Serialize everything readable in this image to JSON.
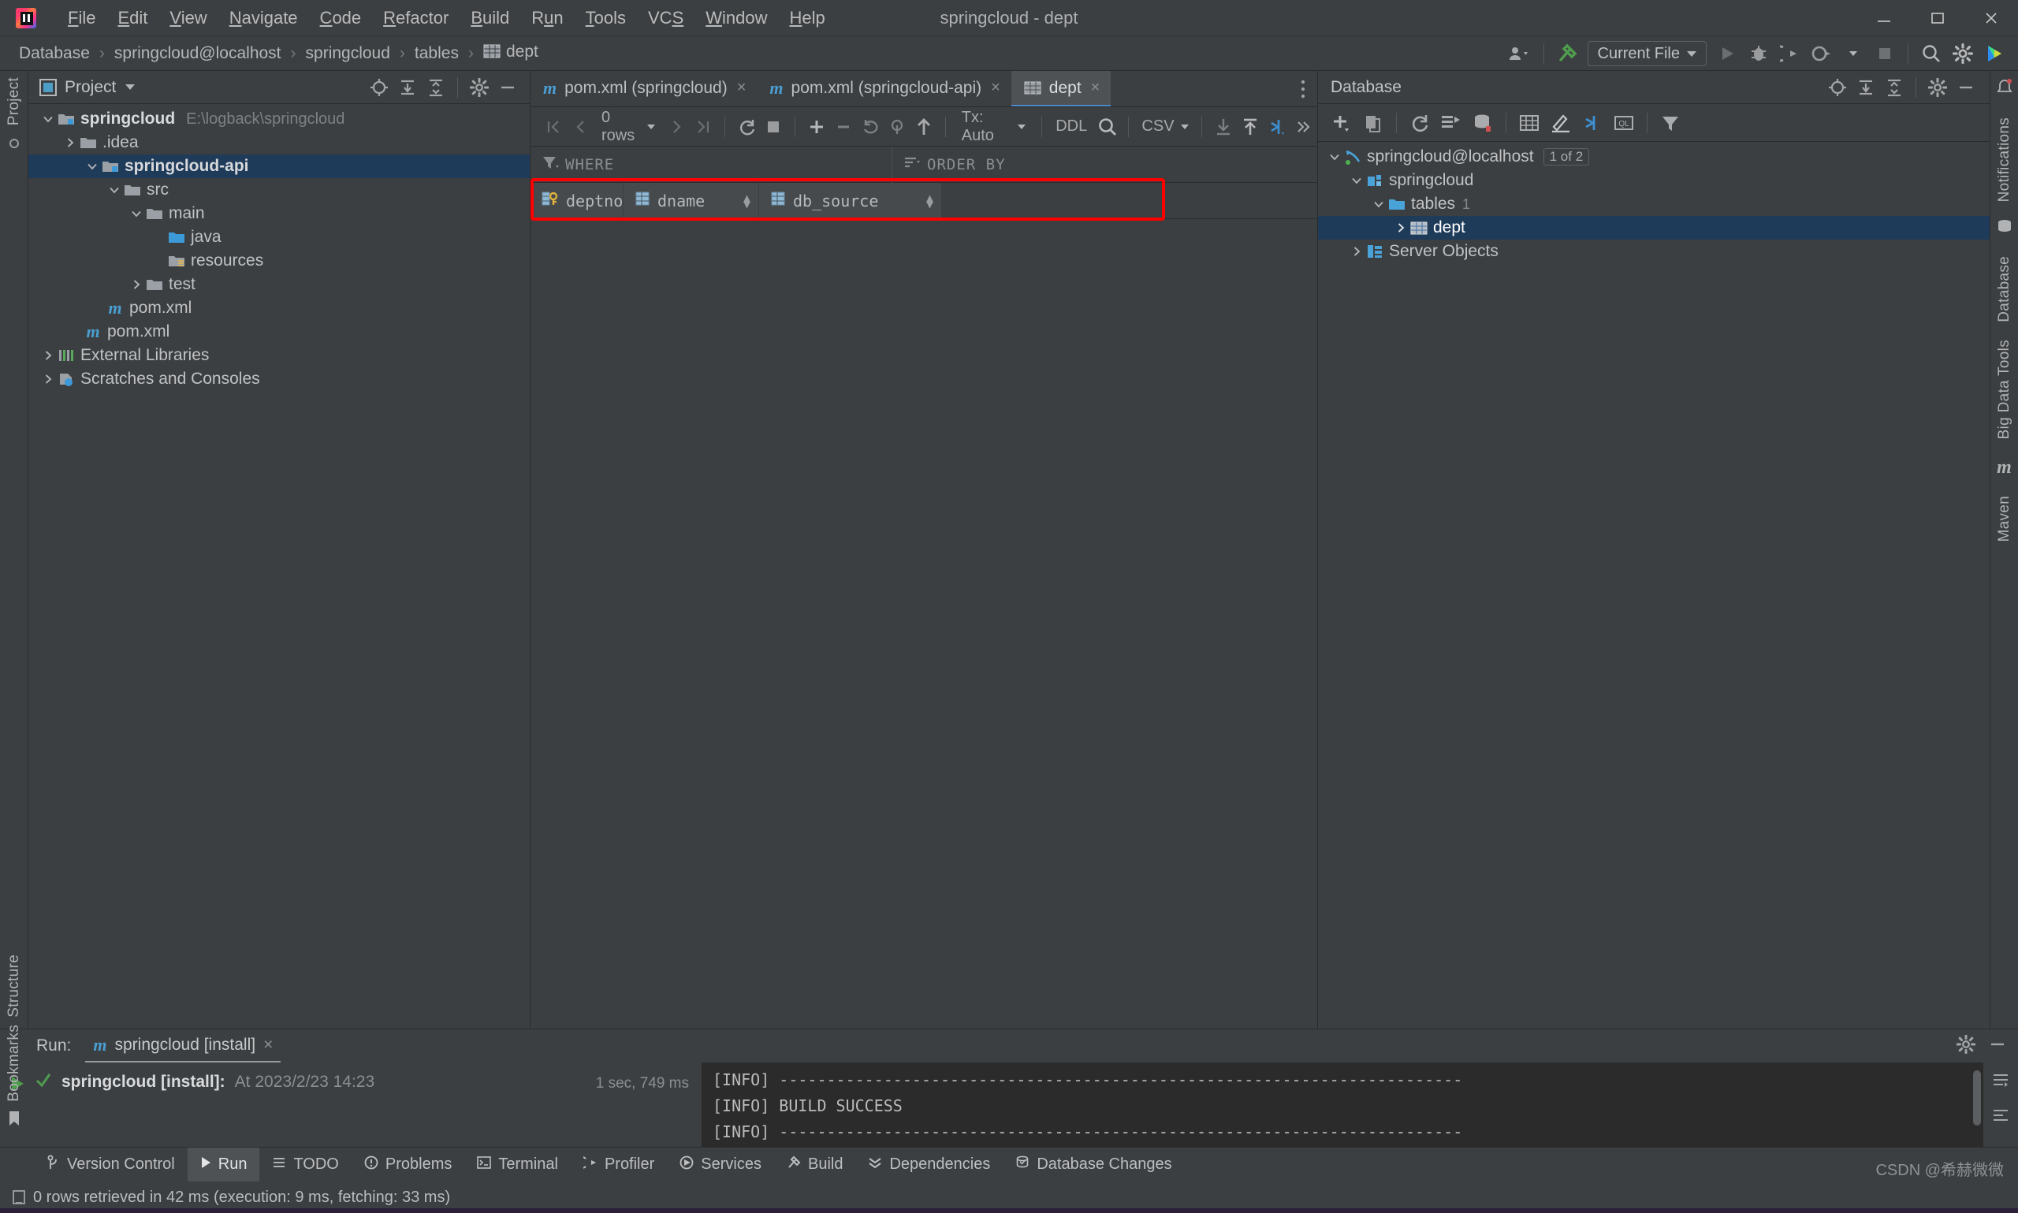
{
  "titlebar": {
    "window_title": "springcloud - dept",
    "menus": [
      "File",
      "Edit",
      "View",
      "Navigate",
      "Code",
      "Refactor",
      "Build",
      "Run",
      "Tools",
      "VCS",
      "Window",
      "Help"
    ],
    "window_buttons": [
      "minimize-button",
      "maximize-button",
      "close-button"
    ]
  },
  "navbar": {
    "breadcrumbs": [
      "Database",
      "springcloud@localhost",
      "springcloud",
      "tables",
      "dept"
    ],
    "separator": "›",
    "run_config": "Current File",
    "icons": [
      "user-dropdown-icon",
      "hammer-build-icon",
      "run-icon",
      "debug-icon",
      "run-with-coverage-icon",
      "profile-icon",
      "stop-icon",
      "search-everywhere-icon",
      "settings-icon",
      "updates-icon"
    ]
  },
  "project_panel": {
    "title": "Project",
    "header_icons": [
      "locate-icon",
      "expand-all-icon",
      "collapse-all-icon",
      "settings-icon",
      "hide-icon"
    ],
    "tree": [
      {
        "label": "springcloud",
        "path": "E:\\logback\\springcloud",
        "depth": 0,
        "arrow": "down",
        "icon": "module-folder-icon",
        "bold": true,
        "selected": false
      },
      {
        "label": ".idea",
        "path": "",
        "depth": 1,
        "arrow": "right",
        "icon": "folder-icon",
        "bold": false,
        "selected": false
      },
      {
        "label": "springcloud-api",
        "path": "",
        "depth": 1,
        "arrow": "down",
        "icon": "module-folder-icon",
        "bold": true,
        "selected": true
      },
      {
        "label": "src",
        "path": "",
        "depth": 2,
        "arrow": "down",
        "icon": "folder-icon",
        "bold": false,
        "selected": false
      },
      {
        "label": "main",
        "path": "",
        "depth": 3,
        "arrow": "down",
        "icon": "folder-icon",
        "bold": false,
        "selected": false
      },
      {
        "label": "java",
        "path": "",
        "depth": 4,
        "arrow": "none",
        "icon": "source-folder-icon",
        "bold": false,
        "selected": false
      },
      {
        "label": "resources",
        "path": "",
        "depth": 4,
        "arrow": "none",
        "icon": "resources-folder-icon",
        "bold": false,
        "selected": false
      },
      {
        "label": "test",
        "path": "",
        "depth": 3,
        "arrow": "right",
        "icon": "folder-icon",
        "bold": false,
        "selected": false
      },
      {
        "label": "pom.xml",
        "path": "",
        "depth": 2,
        "arrow": "none",
        "icon": "maven-icon",
        "bold": false,
        "selected": false
      },
      {
        "label": "pom.xml",
        "path": "",
        "depth": 1,
        "arrow": "none",
        "icon": "maven-icon",
        "bold": false,
        "selected": false
      },
      {
        "label": "External Libraries",
        "path": "",
        "depth": 0,
        "arrow": "right",
        "icon": "libraries-icon",
        "bold": false,
        "selected": false
      },
      {
        "label": "Scratches and Consoles",
        "path": "",
        "depth": 0,
        "arrow": "right",
        "icon": "scratches-icon",
        "bold": false,
        "selected": false
      }
    ]
  },
  "editor": {
    "tabs": [
      {
        "label": "pom.xml (springcloud)",
        "icon": "maven-icon",
        "active": false,
        "close": "×"
      },
      {
        "label": "pom.xml (springcloud-api)",
        "icon": "maven-icon",
        "active": false,
        "close": "×"
      },
      {
        "label": "dept",
        "icon": "table-icon",
        "active": true,
        "close": "×"
      }
    ],
    "grid_toolbar": {
      "rows_label": "0 rows",
      "tx_label": "Tx: Auto",
      "ddl_label": "DDL",
      "csv_label": "CSV",
      "icons": [
        "first-page-icon",
        "prev-page-icon",
        "next-page-icon",
        "last-page-icon",
        "reload-icon",
        "stop-icon",
        "add-row-icon",
        "delete-row-icon",
        "revert-icon",
        "revert-selected-icon",
        "submit-icon",
        "search-icon",
        "import-icon",
        "export-icon",
        "data-extractor-icon",
        "more-icon"
      ]
    },
    "filter_bar": {
      "where_label": "WHERE",
      "order_by_label": "ORDER BY"
    },
    "columns": [
      {
        "name": "deptno",
        "icon": "primary-key-column-icon"
      },
      {
        "name": "dname",
        "icon": "column-icon"
      },
      {
        "name": "db_source",
        "icon": "column-icon"
      }
    ],
    "highlight_color": "#ff0000"
  },
  "database_panel": {
    "title": "Database",
    "header_icons": [
      "locate-icon",
      "expand-all-icon",
      "collapse-all-icon",
      "settings-icon",
      "hide-icon"
    ],
    "toolbar_icons": [
      "new-icon",
      "duplicate-icon",
      "refresh-icon",
      "sync-icon",
      "db-properties-icon",
      "table-editor-icon",
      "modify-icon",
      "jump-to-icon",
      "query-console-icon",
      "filter-icon"
    ],
    "tree": [
      {
        "label": "springcloud@localhost",
        "depth": 0,
        "arrow": "down",
        "icon": "datasource-icon",
        "badge": "1 of 2",
        "count": "",
        "selected": false
      },
      {
        "label": "springcloud",
        "depth": 1,
        "arrow": "down",
        "icon": "schema-icon",
        "badge": "",
        "count": "",
        "selected": false
      },
      {
        "label": "tables",
        "depth": 2,
        "arrow": "down",
        "icon": "folder-icon",
        "badge": "",
        "count": "1",
        "selected": false
      },
      {
        "label": "dept",
        "depth": 3,
        "arrow": "right",
        "icon": "table-icon",
        "badge": "",
        "count": "",
        "selected": true
      },
      {
        "label": "Server Objects",
        "depth": 1,
        "arrow": "right",
        "icon": "server-objects-icon",
        "badge": "",
        "count": "",
        "selected": false
      }
    ]
  },
  "left_rail": {
    "top": "Project",
    "bottom": "Structure",
    "footer": "Bookmarks"
  },
  "right_rail": {
    "items": [
      "Notifications",
      "Database",
      "Big Data Tools",
      "Maven"
    ]
  },
  "run_panel": {
    "run_label": "Run:",
    "tab_label": "springcloud [install]",
    "tab_close": "×",
    "entry_name": "springcloud [install]:",
    "entry_time": "At 2023/2/23 14:23",
    "duration": "1 sec, 749 ms",
    "console_lines": [
      "[INFO] ------------------------------------------------------------------------",
      "[INFO] BUILD SUCCESS",
      "[INFO] ------------------------------------------------------------------------"
    ]
  },
  "tool_tabs": [
    {
      "label": "Version Control",
      "icon": "branch-icon",
      "active": false
    },
    {
      "label": "Run",
      "icon": "run-icon",
      "active": true
    },
    {
      "label": "TODO",
      "icon": "todo-icon",
      "active": false
    },
    {
      "label": "Problems",
      "icon": "problems-icon",
      "active": false
    },
    {
      "label": "Terminal",
      "icon": "terminal-icon",
      "active": false
    },
    {
      "label": "Profiler",
      "icon": "profiler-icon",
      "active": false
    },
    {
      "label": "Services",
      "icon": "services-icon",
      "active": false
    },
    {
      "label": "Build",
      "icon": "build-icon",
      "active": false
    },
    {
      "label": "Dependencies",
      "icon": "dependencies-icon",
      "active": false
    },
    {
      "label": "Database Changes",
      "icon": "database-changes-icon",
      "active": false
    }
  ],
  "statusbar": {
    "message": "0 rows retrieved in 42 ms (execution: 9 ms, fetching: 33 ms)",
    "icon": "console-icon"
  },
  "watermark": "CSDN @希赫微微"
}
